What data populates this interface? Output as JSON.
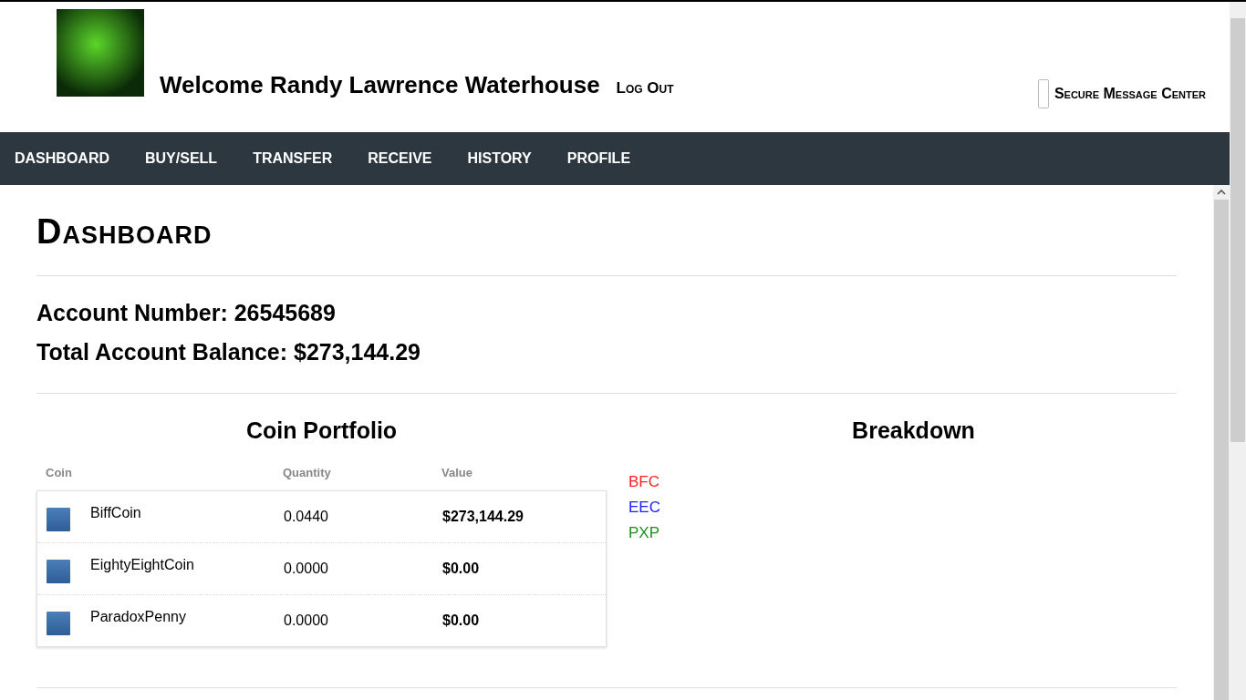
{
  "header": {
    "welcome": "Welcome Randy Lawrence Waterhouse",
    "logout": "Log Out",
    "message_center": "Secure Message Center"
  },
  "nav": [
    {
      "label": "DASHBOARD"
    },
    {
      "label": "BUY/SELL"
    },
    {
      "label": "TRANSFER"
    },
    {
      "label": "RECEIVE"
    },
    {
      "label": "HISTORY"
    },
    {
      "label": "PROFILE"
    }
  ],
  "page_title": "Dashboard",
  "account_number": "Account Number: 26545689",
  "total_balance": "Total Account Balance: $273,144.29",
  "portfolio": {
    "title": "Coin Portfolio",
    "columns": [
      "Coin",
      "Quantity",
      "Value"
    ],
    "rows": [
      {
        "coin": "BiffCoin",
        "quantity": "0.0440",
        "value": "$273,144.29"
      },
      {
        "coin": "EightyEightCoin",
        "quantity": "0.0000",
        "value": "$0.00"
      },
      {
        "coin": "ParadoxPenny",
        "quantity": "0.0000",
        "value": "$0.00"
      }
    ]
  },
  "breakdown": {
    "title": "Breakdown",
    "legend": [
      {
        "label": "BFC",
        "color": "#ff2020"
      },
      {
        "label": "EEC",
        "color": "#2020ff"
      },
      {
        "label": "PXP",
        "color": "#20901e"
      }
    ]
  }
}
